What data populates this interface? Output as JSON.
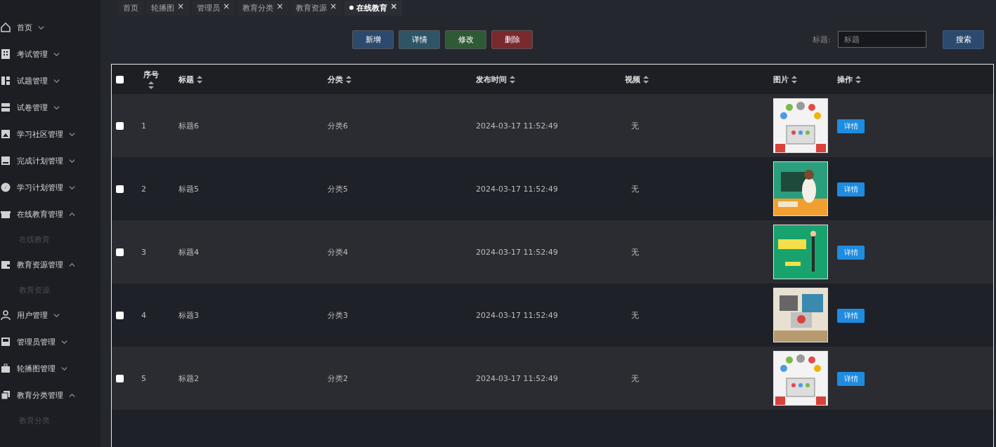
{
  "sidebar": {
    "items": [
      {
        "label": "首页",
        "expanded": false
      },
      {
        "label": "考试管理",
        "expanded": false
      },
      {
        "label": "试题管理",
        "expanded": false
      },
      {
        "label": "试卷管理",
        "expanded": false
      },
      {
        "label": "学习社区管理",
        "expanded": false
      },
      {
        "label": "完成计划管理",
        "expanded": false
      },
      {
        "label": "学习计划管理",
        "expanded": false
      },
      {
        "label": "在线教育管理",
        "expanded": true,
        "children": [
          {
            "label": "在线教育"
          }
        ]
      },
      {
        "label": "教育资源管理",
        "expanded": true,
        "children": [
          {
            "label": "教育资源"
          }
        ]
      },
      {
        "label": "用户管理",
        "expanded": false
      },
      {
        "label": "管理员管理",
        "expanded": false
      },
      {
        "label": "轮播图管理",
        "expanded": false
      },
      {
        "label": "教育分类管理",
        "expanded": true,
        "children": [
          {
            "label": "教育分类"
          }
        ]
      }
    ]
  },
  "tabs": [
    {
      "label": "首页",
      "closable": false,
      "selected": false
    },
    {
      "label": "轮播图",
      "closable": true,
      "selected": false
    },
    {
      "label": "管理员",
      "closable": true,
      "selected": false
    },
    {
      "label": "教育分类",
      "closable": true,
      "selected": false
    },
    {
      "label": "教育资源",
      "closable": true,
      "selected": false
    },
    {
      "label": "在线教育",
      "closable": true,
      "selected": true
    }
  ],
  "tab_close": "×",
  "actions": [
    {
      "label": "新增",
      "kind": "add"
    },
    {
      "label": "详情",
      "kind": "detail"
    },
    {
      "label": "修改",
      "kind": "edit"
    },
    {
      "label": "删除",
      "kind": "delete"
    }
  ],
  "search": {
    "label": "标题:",
    "placeholder": "标题",
    "button": "搜索"
  },
  "table": {
    "select_all": {
      "checked": false
    },
    "columns": [
      "序号",
      "标题",
      "分类",
      "发布时间",
      "视频",
      "图片",
      "操作"
    ],
    "rows": [
      {
        "index": "1",
        "title": "标题6",
        "category": "分类6",
        "time": "2024-03-17 11:52:49",
        "video": "无",
        "action": "详情",
        "checked": false
      },
      {
        "index": "2",
        "title": "标题5",
        "category": "分类5",
        "time": "2024-03-17 11:52:49",
        "video": "无",
        "action": "详情",
        "checked": false
      },
      {
        "index": "3",
        "title": "标题4",
        "category": "分类4",
        "time": "2024-03-17 11:52:49",
        "video": "无",
        "action": "详情",
        "checked": false
      },
      {
        "index": "4",
        "title": "标题3",
        "category": "分类3",
        "time": "2024-03-17 11:52:49",
        "video": "无",
        "action": "详情",
        "checked": false
      },
      {
        "index": "5",
        "title": "标题2",
        "category": "分类2",
        "time": "2024-03-17 11:52:49",
        "video": "无",
        "action": "详情",
        "checked": false
      }
    ]
  }
}
